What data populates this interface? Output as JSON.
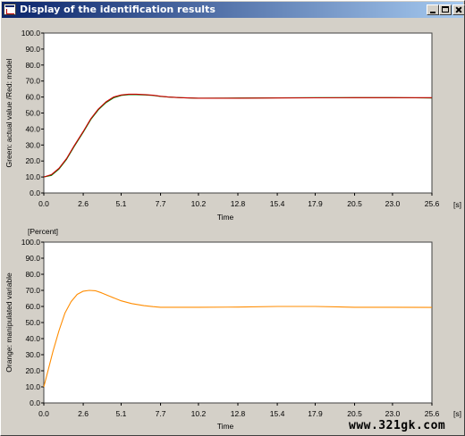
{
  "window": {
    "title": "Display of the identification results",
    "controls": {
      "minimize": "_",
      "maximize": "□",
      "close": "×"
    }
  },
  "watermark": "www.321gk.com",
  "chart_data": [
    {
      "type": "line",
      "ylabel": "Green: actual value /Red: model",
      "xlabel": "Time",
      "unit_label": "[s]",
      "xlim": [
        0,
        25.6
      ],
      "ylim": [
        0,
        100
      ],
      "x_ticks": [
        "0.0",
        "2.6",
        "5.1",
        "7.7",
        "10.2",
        "12.8",
        "15.4",
        "17.9",
        "20.5",
        "23.0",
        "25.6"
      ],
      "y_ticks": [
        "100.0",
        "90.0",
        "80.0",
        "70.0",
        "60.0",
        "50.0",
        "40.0",
        "30.0",
        "20.0",
        "10.0",
        "0.0"
      ],
      "grid": false,
      "series": [
        {
          "name": "Green: actual value",
          "color": "#008000",
          "x": [
            0,
            0.5,
            1.0,
            1.5,
            2.0,
            2.6,
            3.1,
            3.6,
            4.1,
            4.6,
            5.1,
            5.6,
            6.1,
            6.7,
            7.2,
            7.7,
            8.2,
            9.0,
            10.2,
            12.8,
            15.4,
            17.9,
            20.5,
            23.0,
            24.5,
            25.6
          ],
          "values": [
            10,
            11,
            15,
            21,
            29,
            38,
            46,
            52,
            56.5,
            59.5,
            61,
            61.5,
            61.5,
            61.3,
            61,
            60.4,
            60,
            59.6,
            59.3,
            59.4,
            59.5,
            59.6,
            59.6,
            59.6,
            59.5,
            59.4
          ]
        },
        {
          "name": "Red: model",
          "color": "#cc0000",
          "x": [
            0,
            0.5,
            1.0,
            1.5,
            2.0,
            2.6,
            3.1,
            3.6,
            4.1,
            4.6,
            5.1,
            5.6,
            6.1,
            6.7,
            7.2,
            7.7,
            8.2,
            9.0,
            10.2,
            12.8,
            15.4,
            17.9,
            20.5,
            23.0,
            25.6
          ],
          "values": [
            10,
            11.5,
            15.5,
            21.5,
            29.5,
            38.5,
            46.5,
            52.5,
            57,
            60,
            61.3,
            61.8,
            61.8,
            61.5,
            61.1,
            60.5,
            60,
            59.6,
            59.3,
            59.3,
            59.4,
            59.5,
            59.6,
            59.6,
            59.6
          ]
        }
      ]
    },
    {
      "type": "line",
      "unit_title": "[Percent]",
      "ylabel": "Orange: manipulated variable",
      "xlabel": "Time",
      "unit_label": "[s]",
      "xlim": [
        0,
        25.6
      ],
      "ylim": [
        0,
        100
      ],
      "x_ticks": [
        "0.0",
        "2.6",
        "5.1",
        "7.7",
        "10.2",
        "12.8",
        "15.4",
        "17.9",
        "20.5",
        "23.0",
        "25.6"
      ],
      "y_ticks": [
        "100.0",
        "90.0",
        "80.0",
        "70.0",
        "60.0",
        "50.0",
        "40.0",
        "30.0",
        "20.0",
        "10.0",
        "0.0"
      ],
      "grid": false,
      "series": [
        {
          "name": "Orange: manipulated variable",
          "color": "#ff8c00",
          "x": [
            0,
            0.3,
            0.6,
            1.0,
            1.4,
            1.8,
            2.2,
            2.6,
            3.0,
            3.4,
            3.8,
            4.3,
            5.1,
            5.8,
            6.6,
            7.2,
            7.7,
            10.2,
            12.8,
            15.4,
            17.9,
            20.5,
            23.0,
            25.6
          ],
          "values": [
            10,
            21,
            32,
            45,
            56,
            63,
            67.5,
            69.5,
            70,
            69.8,
            68.5,
            66.5,
            63.5,
            61.8,
            60.5,
            59.9,
            59.5,
            59.5,
            59.6,
            60,
            60,
            59.5,
            59.5,
            59.4
          ]
        }
      ]
    }
  ]
}
